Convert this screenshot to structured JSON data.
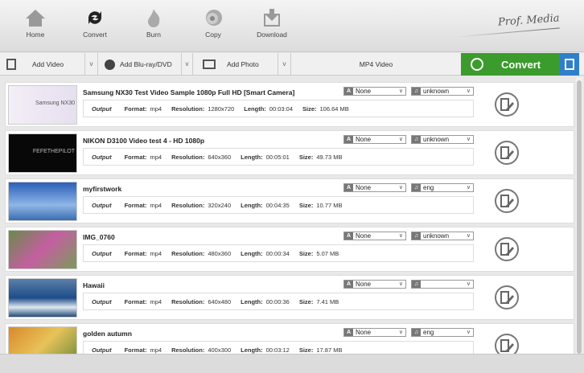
{
  "toolbar": {
    "home": "Home",
    "convert": "Convert",
    "burn": "Burn",
    "copy": "Copy",
    "download": "Download",
    "logo": "Prof. Media"
  },
  "actions": {
    "add_video": "Add Video",
    "add_bluray": "Add Blu-ray/DVD",
    "add_photo": "Add Photo",
    "format": "MP4 Video",
    "convert": "Convert"
  },
  "labels": {
    "output": "Output",
    "format": "Format:",
    "resolution": "Resolution:",
    "length": "Length:",
    "size": "Size:"
  },
  "colors": {
    "convert_green": "#3b9b2c",
    "side_blue": "#2f7fc9"
  },
  "items": [
    {
      "title": "Samsung NX30 Test Video Sample 1080p Full HD [Smart Camera]",
      "subtitle": "None",
      "audio": "unknown",
      "format": "mp4",
      "resolution": "1280x720",
      "length": "00:03:04",
      "size": "106.64 MB",
      "thumb_text": "Samsung NX30"
    },
    {
      "title": "NIKON D3100 Video test 4 - HD 1080p",
      "subtitle": "None",
      "audio": "unknown",
      "format": "mp4",
      "resolution": "640x360",
      "length": "00:05:01",
      "size": "49.73 MB",
      "thumb_text": "FEFETHEPILOT"
    },
    {
      "title": "myfirstwork",
      "subtitle": "None",
      "audio": "eng",
      "format": "mp4",
      "resolution": "320x240",
      "length": "00:04:35",
      "size": "10.77 MB"
    },
    {
      "title": "IMG_0760",
      "subtitle": "None",
      "audio": "unknown",
      "format": "mp4",
      "resolution": "480x360",
      "length": "00:00:34",
      "size": "5.07 MB"
    },
    {
      "title": "Hawaii",
      "subtitle": "None",
      "audio": "",
      "format": "mp4",
      "resolution": "640x480",
      "length": "00:00:36",
      "size": "7.41 MB"
    },
    {
      "title": "golden autumn",
      "subtitle": "None",
      "audio": "eng",
      "format": "mp4",
      "resolution": "400x300",
      "length": "00:03:12",
      "size": "17.87 MB"
    }
  ]
}
